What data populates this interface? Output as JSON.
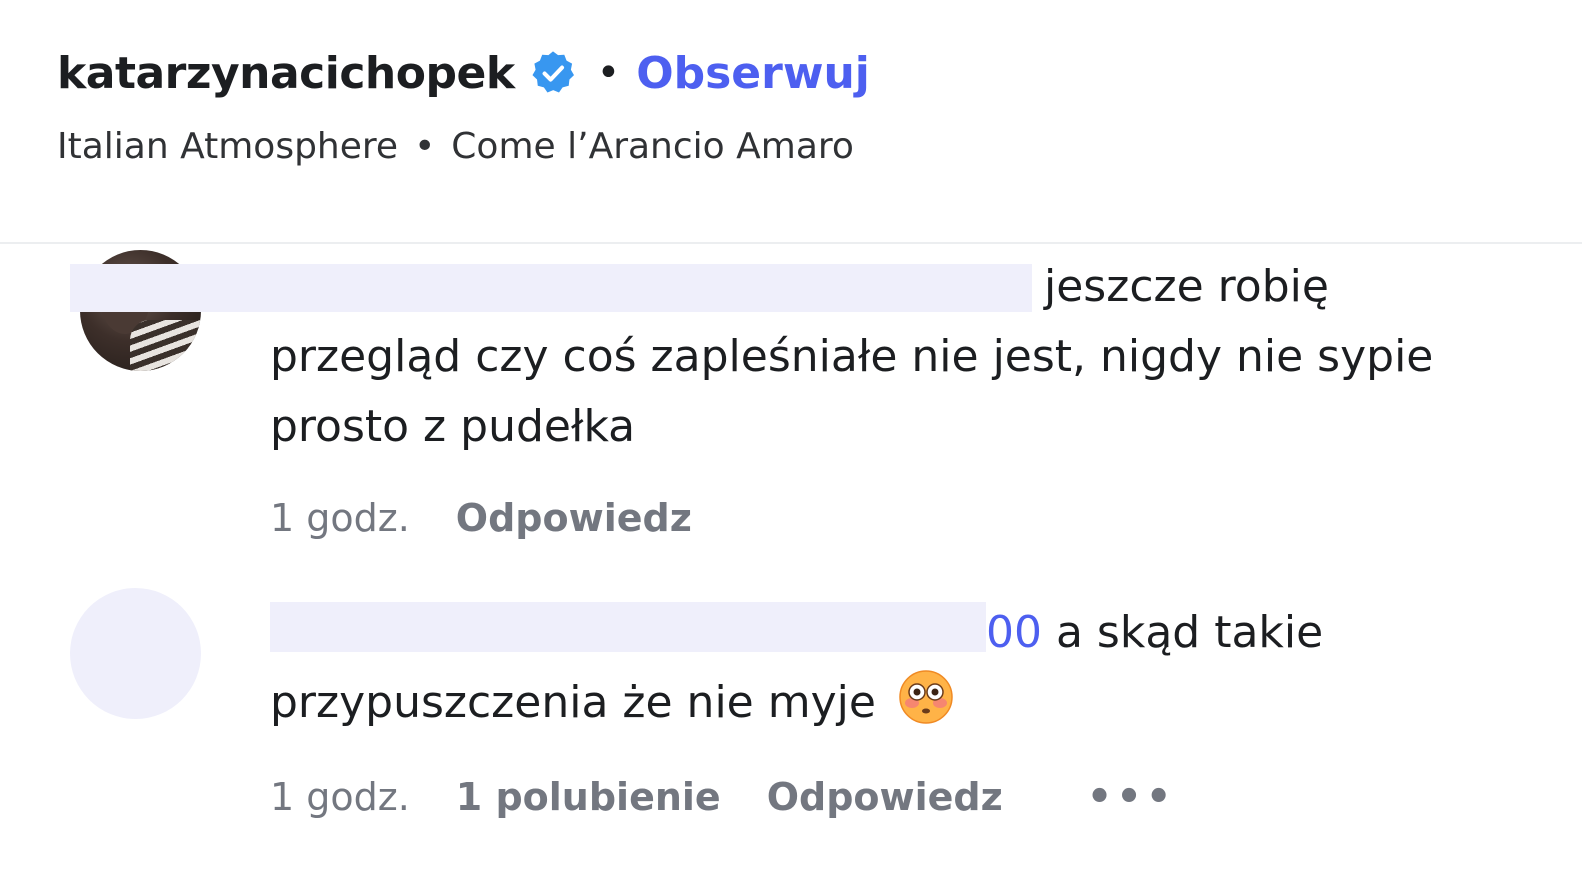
{
  "header": {
    "username": "katarzynacichopek",
    "verified_icon": "verified-badge-icon",
    "separator": "•",
    "follow_label": "Obserwuj",
    "music_artist": "Italian Atmosphere",
    "music_separator": "•",
    "music_title": "Come l’Arancio Amaro"
  },
  "comments": [
    {
      "text_line1": "jeszcze robię",
      "text_rest": "przegląd czy coś zapleśniałe nie jest, nigdy nie sypie prosto z pudełka",
      "time": "1 godz.",
      "reply_label": "Odpowiedz"
    },
    {
      "mention_tail": "00",
      "text_line1": " a skąd takie",
      "text_rest": "przypuszczenia że nie myje",
      "emoji": "flushed-face-icon",
      "time": "1 godz.",
      "likes": "1 polubienie",
      "reply_label": "Odpowiedz",
      "more_label": "•••"
    }
  ],
  "colors": {
    "accent": "#4d5ff0",
    "verified": "#3897f0",
    "meta_text": "#737780",
    "redaction": "#efeffb"
  }
}
